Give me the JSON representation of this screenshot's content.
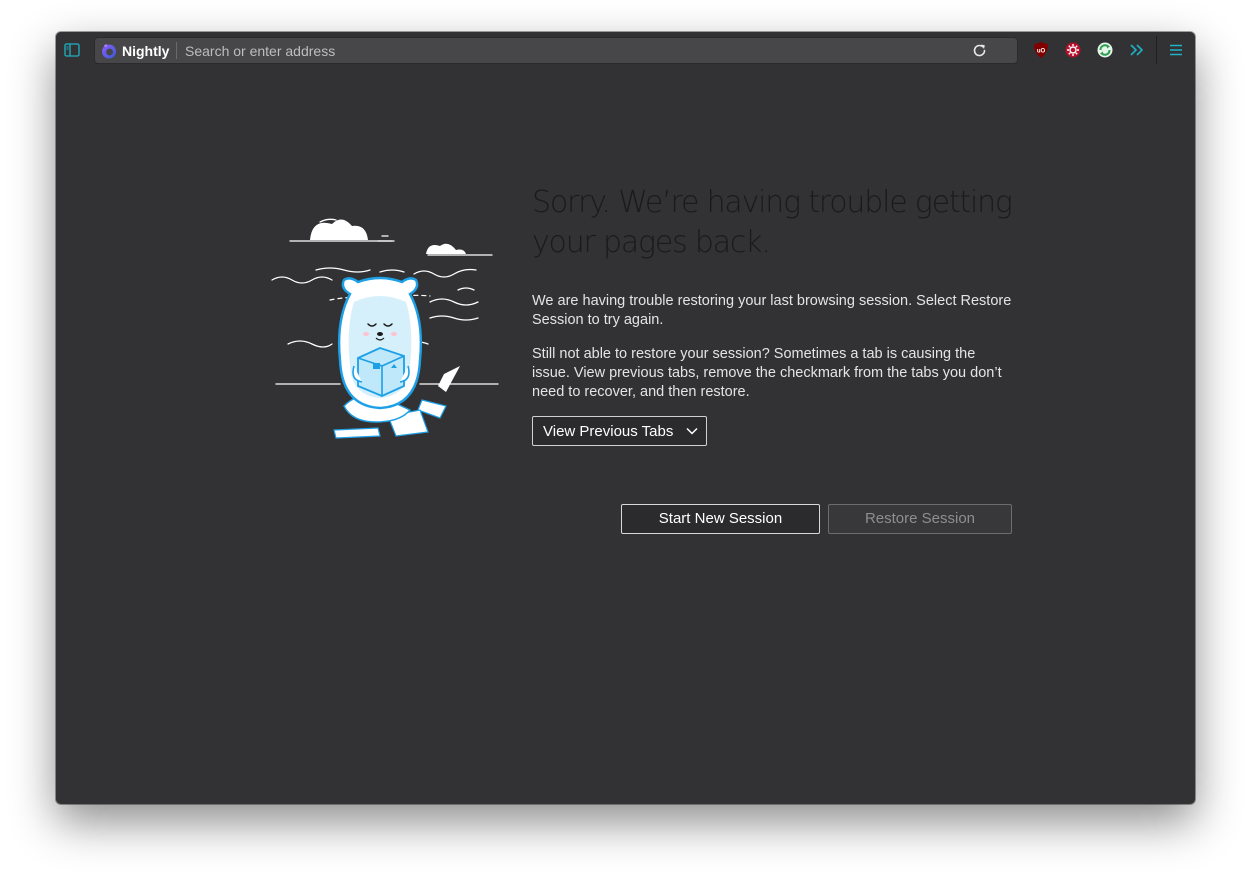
{
  "browser": {
    "brand": "Nightly",
    "urlbar_placeholder": "Search or enter address",
    "accent_color": "#1eb1c4"
  },
  "toolbar_icons": [
    "sidebar-toggle-icon",
    "nightly-logo-icon",
    "reload-icon",
    "ublock-origin-icon",
    "extension-red-gear-icon",
    "extension-green-sync-icon",
    "overflow-chevrons-icon",
    "hamburger-menu-icon"
  ],
  "session_restore": {
    "title": "Sorry. We’re having trouble getting your pages back.",
    "paragraph_1": "We are having trouble restoring your last browsing session. Select Restore Session to try again.",
    "paragraph_2": "Still not able to restore your session? Sometimes a tab is causing the issue. View previous tabs, remove the checkmark from the tabs you don’t need to recover, and then restore.",
    "view_tabs_label": "View Previous Tabs",
    "start_new_label": "Start New Session",
    "restore_label": "Restore Session",
    "restore_enabled": false
  }
}
